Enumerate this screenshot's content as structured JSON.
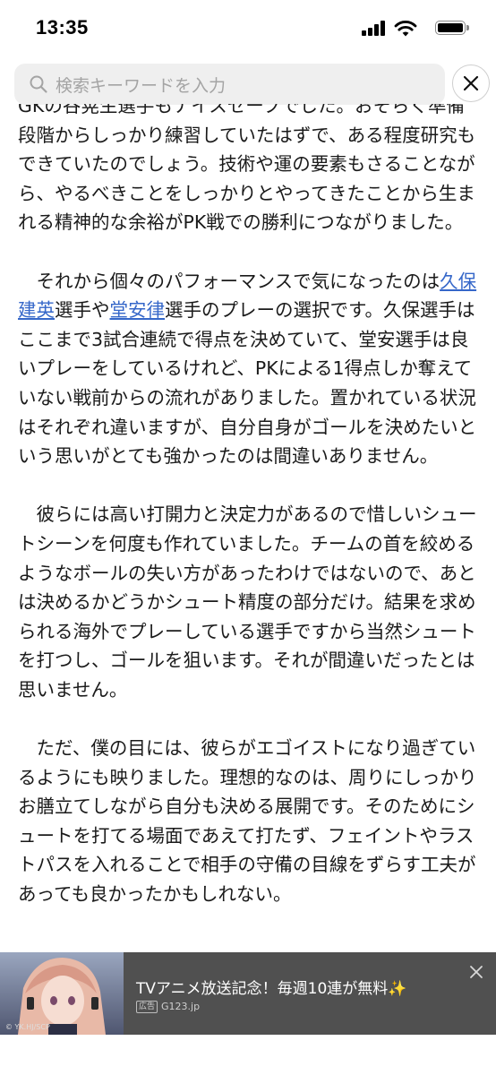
{
  "status_bar": {
    "time": "13:35"
  },
  "search": {
    "placeholder": "検索キーワードを入力"
  },
  "article": {
    "paragraphs": [
      {
        "text": "GKの谷晃生選手もナイスセーブでした。おそらく準備段階からしっかり練習していたはずで、ある程度研究もできていたのでしょう。技術や運の要素もさることながら、やるべきことをしっかりとやってきたことから生まれる精神的な余裕がPK戦での勝利につながりました。"
      },
      {
        "pre": "　それから個々のパフォーマンスで気になったのは",
        "link1": "久保建英",
        "mid": "選手や",
        "link2": "堂安律",
        "post": "選手のプレーの選択です。久保選手はここまで3試合連続で得点を決めていて、堂安選手は良いプレーをしているけれど、PKによる1得点しか奪えていない戦前からの流れがありました。置かれている状況はそれぞれ違いますが、自分自身がゴールを決めたいという思いがとても強かったのは間違いありません。"
      },
      {
        "text": "　彼らには高い打開力と決定力があるので惜しいシュートシーンを何度も作れていました。チームの首を絞めるようなボールの失い方があったわけではないので、あとは決めるかどうかシュート精度の部分だけ。結果を求められる海外でプレーしている選手ですから当然シュートを打つし、ゴールを狙います。それが間違いだったとは思いません。"
      },
      {
        "text": "　ただ、僕の目には、彼らがエゴイストになり過ぎているようにも映りました。理想的なのは、周りにしっかりお膳立てしながら自分も決める展開です。そのためにシュートを打てる場面であえて打たず、フェイントやラストパスを入れることで相手の守備の目線をずらす工夫があっても良かったかもしれない。"
      }
    ]
  },
  "ad": {
    "title": "TVアニメ放送記念！毎週10連が無料✨",
    "badge": "広告",
    "domain": "G123.jp",
    "image_credit": "© YK.HJ/SCP"
  },
  "colors": {
    "link": "#3567c9",
    "ad_background": "#505050",
    "search_background": "#efefef"
  },
  "icons": [
    "search-icon",
    "close-icon",
    "signal-icon",
    "wifi-icon",
    "battery-icon",
    "ad-close-icon"
  ]
}
